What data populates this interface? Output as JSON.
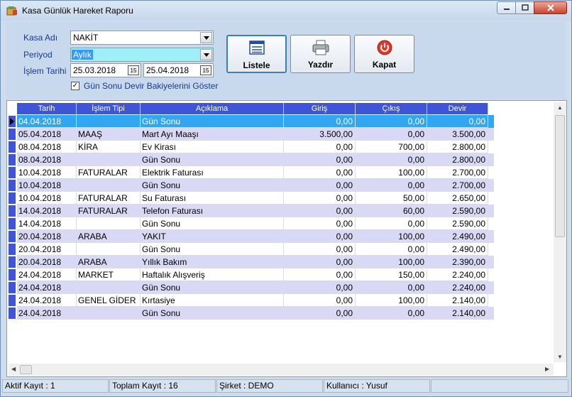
{
  "window": {
    "title": "Kasa Günlük Hareket Raporu",
    "app_icon": "report-icon",
    "controls": [
      "minimize-icon",
      "maximize-icon",
      "close-icon"
    ]
  },
  "form": {
    "kasa_label": "Kasa Adı",
    "kasa_value": "NAKİT",
    "periyod_label": "Periyod",
    "periyod_value": "Aylık",
    "tarih_label": "İşlem Tarihi",
    "start_date": "25.03.2018",
    "end_date": "25.04.2018",
    "checkbox_label": "Gün Sonu Devir Bakiyelerini Göster",
    "checkbox_checked": true
  },
  "buttons": {
    "listele": "Listele",
    "yazdir": "Yazdır",
    "kapat": "Kapat"
  },
  "grid": {
    "columns": [
      "Tarih",
      "İşlem Tipi",
      "Açıklama",
      "Giriş",
      "Çıkış",
      "Devir"
    ],
    "rows": [
      [
        "04.04.2018",
        "",
        "Gün Sonu",
        "0,00",
        "0,00",
        "0,00"
      ],
      [
        "05.04.2018",
        "MAAŞ",
        "Mart Ayı Maaşı",
        "3.500,00",
        "0,00",
        "3.500,00"
      ],
      [
        "08.04.2018",
        "KİRA",
        "Ev Kirası",
        "0,00",
        "700,00",
        "2.800,00"
      ],
      [
        "08.04.2018",
        "",
        "Gün Sonu",
        "0,00",
        "0,00",
        "2.800,00"
      ],
      [
        "10.04.2018",
        "FATURALAR",
        "Elektrik Faturası",
        "0,00",
        "100,00",
        "2.700,00"
      ],
      [
        "10.04.2018",
        "",
        "Gün Sonu",
        "0,00",
        "0,00",
        "2.700,00"
      ],
      [
        "10.04.2018",
        "FATURALAR",
        "Su Faturası",
        "0,00",
        "50,00",
        "2.650,00"
      ],
      [
        "14.04.2018",
        "FATURALAR",
        "Telefon Faturası",
        "0,00",
        "60,00",
        "2.590,00"
      ],
      [
        "14.04.2018",
        "",
        "Gün Sonu",
        "0,00",
        "0,00",
        "2.590,00"
      ],
      [
        "20.04.2018",
        "ARABA",
        "YAKIT",
        "0,00",
        "100,00",
        "2.490,00"
      ],
      [
        "20.04.2018",
        "",
        "Gün Sonu",
        "0,00",
        "0,00",
        "2.490,00"
      ],
      [
        "20.04.2018",
        "ARABA",
        "Yıllık Bakım",
        "0,00",
        "100,00",
        "2.390,00"
      ],
      [
        "24.04.2018",
        "MARKET",
        "Haftalık Alışveriş",
        "0,00",
        "150,00",
        "2.240,00"
      ],
      [
        "24.04.2018",
        "",
        "Gün Sonu",
        "0,00",
        "0,00",
        "2.240,00"
      ],
      [
        "24.04.2018",
        "GENEL GİDER",
        "Kırtasiye",
        "0,00",
        "100,00",
        "2.140,00"
      ],
      [
        "24.04.2018",
        "",
        "Gün Sonu",
        "0,00",
        "0,00",
        "2.140,00"
      ]
    ],
    "selected_row": 0
  },
  "status": {
    "aktif": "Aktif Kayıt : 1",
    "toplam": "Toplam Kayıt : 16",
    "sirket": "Şirket : DEMO",
    "kullanici": "Kullanıcı : Yusuf"
  },
  "colors": {
    "header": "#3d55d6",
    "selected_row": "#33a6f2",
    "alt_row": "#d9d9f5",
    "window_bg": "#cfdcec"
  }
}
